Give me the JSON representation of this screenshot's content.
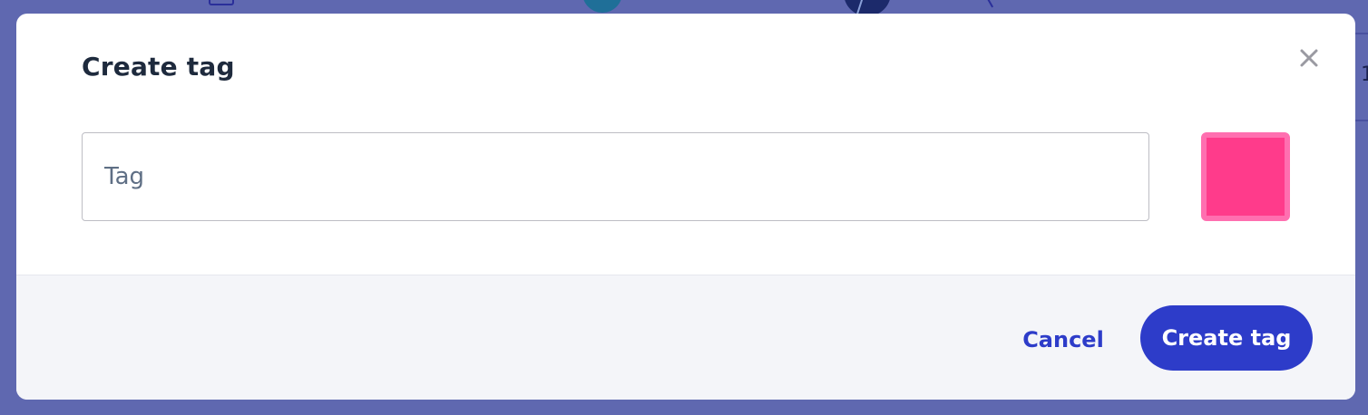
{
  "modal": {
    "title": "Create tag",
    "close_icon": "close-icon",
    "tag_input": {
      "value": "",
      "placeholder": "Tag"
    },
    "color_swatch": {
      "color": "#ff3b8b",
      "border_color": "#ff6fb0"
    },
    "footer": {
      "cancel_label": "Cancel",
      "create_label": "Create tag"
    }
  },
  "background": {
    "right_edge_text": "1"
  },
  "colors": {
    "backdrop": "#5f68b0",
    "primary": "#2d3cc9",
    "title_text": "#1e2a3d",
    "placeholder_text": "#5f6f85",
    "footer_bg": "#f4f5f9"
  }
}
